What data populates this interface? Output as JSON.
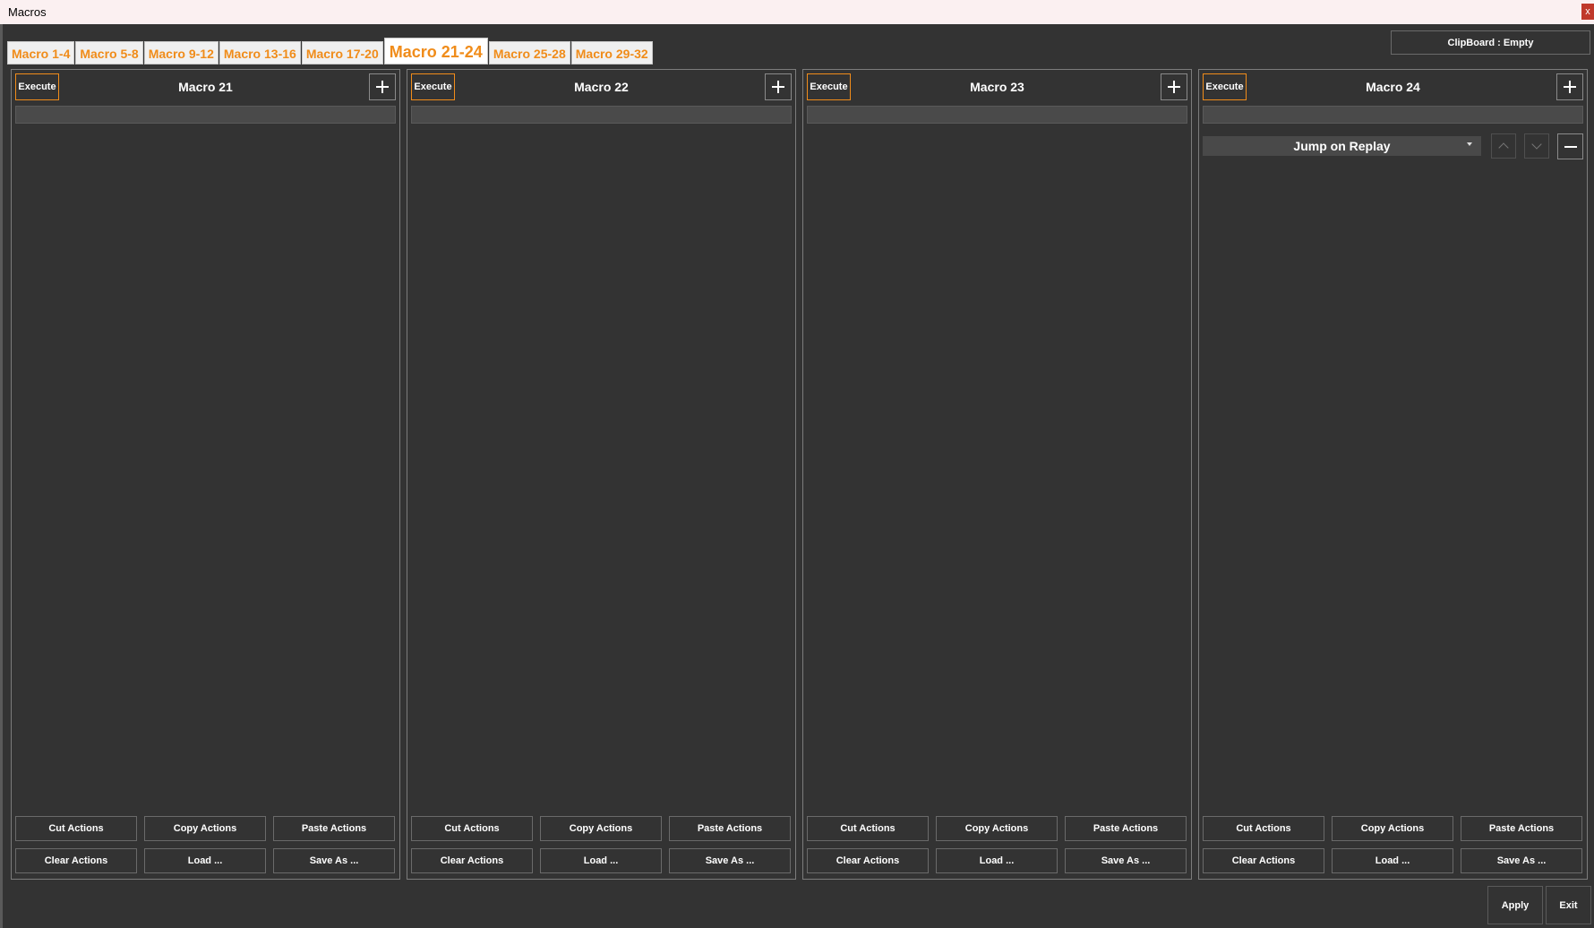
{
  "window": {
    "title": "Macros",
    "close_label": "x"
  },
  "tabs": [
    {
      "label": "Macro 1-4"
    },
    {
      "label": "Macro 5-8"
    },
    {
      "label": "Macro 9-12"
    },
    {
      "label": "Macro 13-16"
    },
    {
      "label": "Macro 17-20"
    },
    {
      "label": "Macro 21-24"
    },
    {
      "label": "Macro 25-28"
    },
    {
      "label": "Macro 29-32"
    }
  ],
  "active_tab": "Macro 21-24",
  "clipboard": {
    "label": "ClipBoard : Empty"
  },
  "panels": [
    {
      "title": "Macro 21",
      "execute_label": "Execute"
    },
    {
      "title": "Macro 22",
      "execute_label": "Execute"
    },
    {
      "title": "Macro 23",
      "execute_label": "Execute"
    },
    {
      "title": "Macro 24",
      "execute_label": "Execute",
      "action": {
        "selected": "Jump on Replay"
      }
    }
  ],
  "panel_buttons": {
    "cut": "Cut Actions",
    "copy": "Copy Actions",
    "paste": "Paste Actions",
    "clear": "Clear Actions",
    "load": "Load ...",
    "save_as": "Save As ..."
  },
  "footer": {
    "apply": "Apply",
    "exit": "Exit"
  },
  "colors": {
    "accent": "#f08c1a",
    "background": "#333333",
    "title_bar": "#fbf0f1",
    "close": "#c0392b"
  }
}
